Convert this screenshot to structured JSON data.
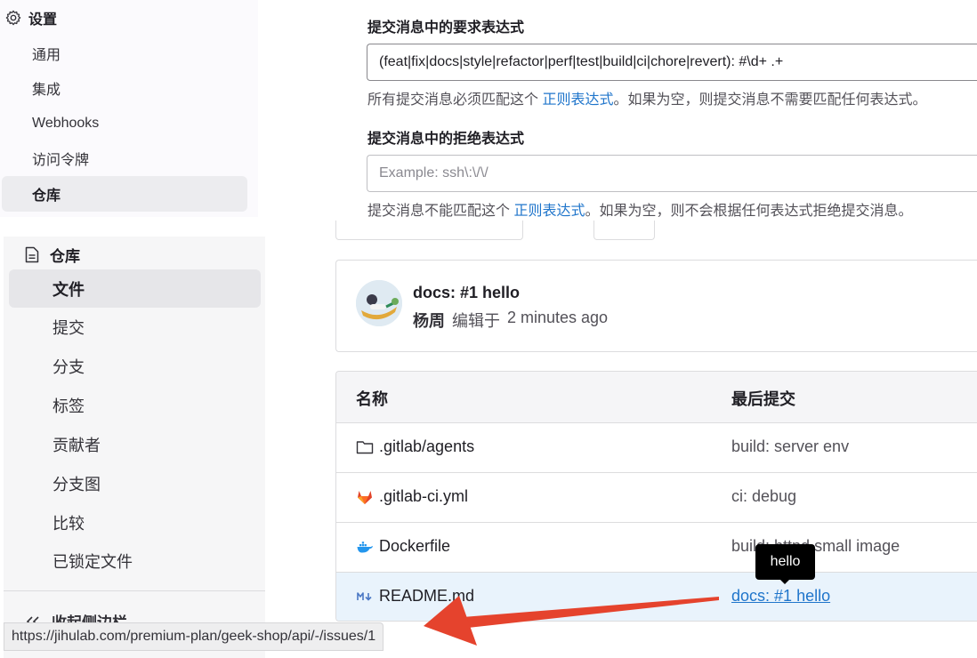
{
  "settings_sidebar": {
    "title": "设置",
    "items": [
      {
        "label": "通用"
      },
      {
        "label": "集成"
      },
      {
        "label": "Webhooks"
      },
      {
        "label": "访问令牌"
      },
      {
        "label": "仓库",
        "active": true
      }
    ]
  },
  "regex_settings": {
    "require_label": "提交消息中的要求表达式",
    "require_value": "(feat|fix|docs|style|refactor|perf|test|build|ci|chore|revert): #\\d+ .+",
    "require_help_prefix": "所有提交消息必须匹配这个",
    "require_help_link": "正则表达式",
    "require_help_suffix": "。如果为空，则提交消息不需要匹配任何表达式。",
    "reject_label": "提交消息中的拒绝表达式",
    "reject_placeholder": "Example: ssh\\:\\/\\/",
    "reject_help_prefix": "提交消息不能匹配这个",
    "reject_help_link": "正则表达式",
    "reject_help_suffix": "。如果为空，则不会根据任何表达式拒绝提交消息。"
  },
  "repo_nav": {
    "title": "仓库",
    "items": [
      {
        "label": "文件",
        "active": true
      },
      {
        "label": "提交"
      },
      {
        "label": "分支"
      },
      {
        "label": "标签"
      },
      {
        "label": "贡献者"
      },
      {
        "label": "分支图"
      },
      {
        "label": "比较"
      },
      {
        "label": "已锁定文件"
      }
    ],
    "collapse_label": "收起侧边栏"
  },
  "last_commit": {
    "title": "docs: #1 hello",
    "author": "杨周",
    "edited_label": "编辑于",
    "time": "2 minutes ago"
  },
  "file_table": {
    "col_name": "名称",
    "col_commit": "最后提交",
    "rows": [
      {
        "name": ".gitlab/agents",
        "icon": "folder-icon",
        "commit": "build: server env"
      },
      {
        "name": ".gitlab-ci.yml",
        "icon": "gitlab-icon",
        "commit": "ci: debug"
      },
      {
        "name": "Dockerfile",
        "icon": "docker-icon",
        "commit": "build: httpd small image"
      },
      {
        "name": "README.md",
        "icon": "markdown-icon",
        "commit_prefix": "docs: ",
        "commit_issue": "#1",
        "commit_suffix": " hello"
      }
    ]
  },
  "tooltip": {
    "text": "hello"
  },
  "statusbar": {
    "url": "https://jihulab.com/premium-plan/geek-shop/api/-/issues/1"
  },
  "colors": {
    "link": "#1f75cb",
    "annotation_arrow": "#e5432d",
    "hover_row": "#e9f3fc"
  }
}
